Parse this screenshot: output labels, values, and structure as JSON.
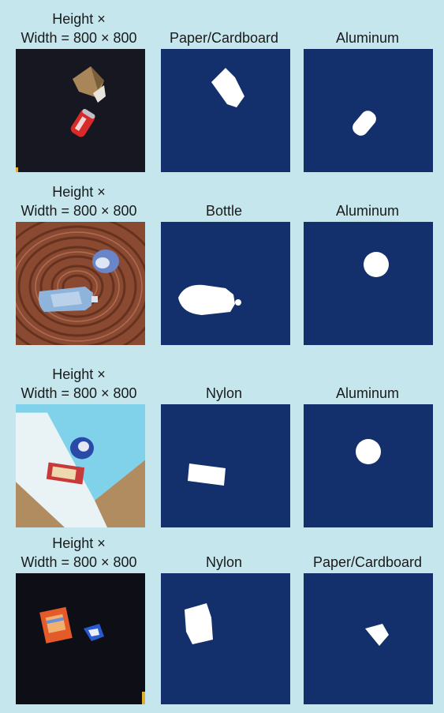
{
  "rows": [
    {
      "input_label_line1": "Height ×",
      "input_label_line2": "Width = 800 × 800",
      "mask_labels": [
        "Paper/Cardboard",
        "Aluminum"
      ],
      "scene": "dark surface with cardboard piece and red aluminum can"
    },
    {
      "input_label_line1": "Height ×",
      "input_label_line2": "Width = 800 × 800",
      "mask_labels": [
        "Bottle",
        "Aluminum"
      ],
      "scene": "wooden tree-ring surface with crushed plastic bottle and blue can"
    },
    {
      "input_label_line1": "Height ×",
      "input_label_line2": "Width = 800 × 800",
      "mask_labels": [
        "Nylon",
        "Aluminum"
      ],
      "scene": "light blue and white surface with blue can and nylon wrapper"
    },
    {
      "input_label_line1": "Height ×",
      "input_label_line2": "Width = 800 × 800",
      "mask_labels": [
        "Nylon",
        "Paper/Cardboard"
      ],
      "scene": "dark surface with orange nylon wrapper and blue cardboard piece"
    }
  ],
  "colors": {
    "background": "#c5e6ec",
    "mask_background": "#132f6c",
    "mask_foreground": "#ffffff"
  }
}
